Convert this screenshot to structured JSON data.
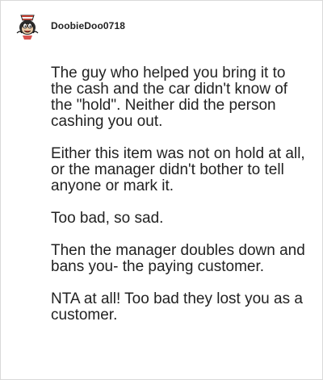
{
  "comment": {
    "username": "DoobieDoo0718",
    "avatar_icon": "cartoon-character-avatar-icon",
    "paragraphs": [
      "The guy who helped you bring it to the cash and the car didn't know of the \"hold\". Neither did the person cashing you out.",
      "Either this item was not on hold at all, or the manager didn't bother to tell anyone or mark it.",
      "Too bad, so sad.",
      "Then the manager doubles down and bans you- the paying customer.",
      "NTA at all! Too bad they lost you as a customer."
    ]
  },
  "colors": {
    "text": "#222222",
    "border": "#d9d9d9",
    "background": "#ffffff"
  }
}
